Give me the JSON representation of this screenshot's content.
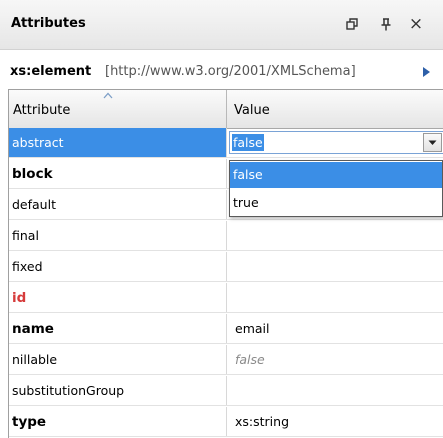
{
  "panel": {
    "title": "Attributes",
    "close_glyph": "×",
    "icons": [
      "restore-icon",
      "pin-icon",
      "close-icon"
    ]
  },
  "path": {
    "element": "xs:element",
    "namespace": "[http://www.w3.org/2001/XMLSchema]",
    "arrow_icon": "play-arrow-icon"
  },
  "table": {
    "columns": [
      "Attribute",
      "Value"
    ],
    "sorted_column": "Attribute",
    "rows": [
      {
        "name": "abstract",
        "value": "false",
        "style": "selected"
      },
      {
        "name": "block",
        "value": "",
        "style": "bold"
      },
      {
        "name": "default",
        "value": "",
        "style": "normal"
      },
      {
        "name": "final",
        "value": "",
        "style": "normal"
      },
      {
        "name": "fixed",
        "value": "",
        "style": "normal"
      },
      {
        "name": "id",
        "value": "",
        "style": "red"
      },
      {
        "name": "name",
        "value": "email",
        "style": "bold"
      },
      {
        "name": "nillable",
        "value": "false",
        "style": "default"
      },
      {
        "name": "substitutionGroup",
        "value": "",
        "style": "normal"
      },
      {
        "name": "type",
        "value": "xs:string",
        "style": "bold"
      }
    ]
  },
  "dropdown": {
    "options": [
      "false",
      "true"
    ],
    "selected": "false"
  },
  "colors": {
    "selection": "#3b8ee6",
    "required_attr": "#d63b3b",
    "default_value": "#8a8a8a"
  }
}
